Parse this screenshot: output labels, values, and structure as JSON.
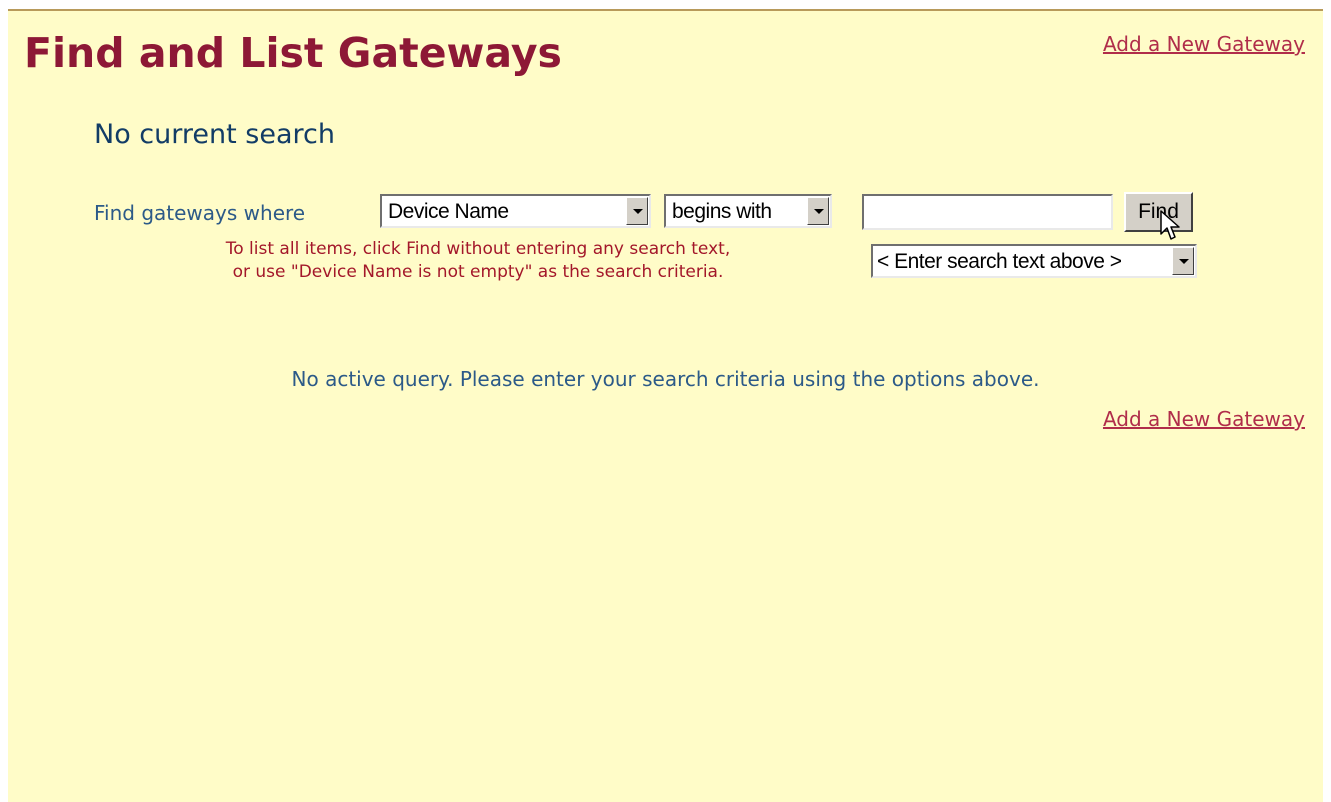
{
  "colors": {
    "panel_background": "#fffcc8",
    "title": "#8d1836",
    "link": "#b02d4a",
    "heading": "#123c66",
    "label": "#2c5a88",
    "hint": "#a3172a"
  },
  "header": {
    "title": "Find and List Gateways",
    "add_link_top": "Add a New Gateway"
  },
  "search": {
    "status": "No current search",
    "label": "Find gateways where",
    "field_select": "Device Name",
    "operator_select": "begins with",
    "input_value": "",
    "find_button": "Find",
    "criteria_select": "< Enter search text above >",
    "hint_line1": "To list all items, click Find without entering any search text,",
    "hint_line2": "or use \"Device Name is not empty\" as the search criteria."
  },
  "results": {
    "message": "No active query. Please enter your search criteria using the options above.",
    "add_link_bottom": "Add a New Gateway"
  },
  "icons": {
    "dropdown_arrow": "chevron-down-icon",
    "mouse_cursor": "cursor-icon"
  }
}
